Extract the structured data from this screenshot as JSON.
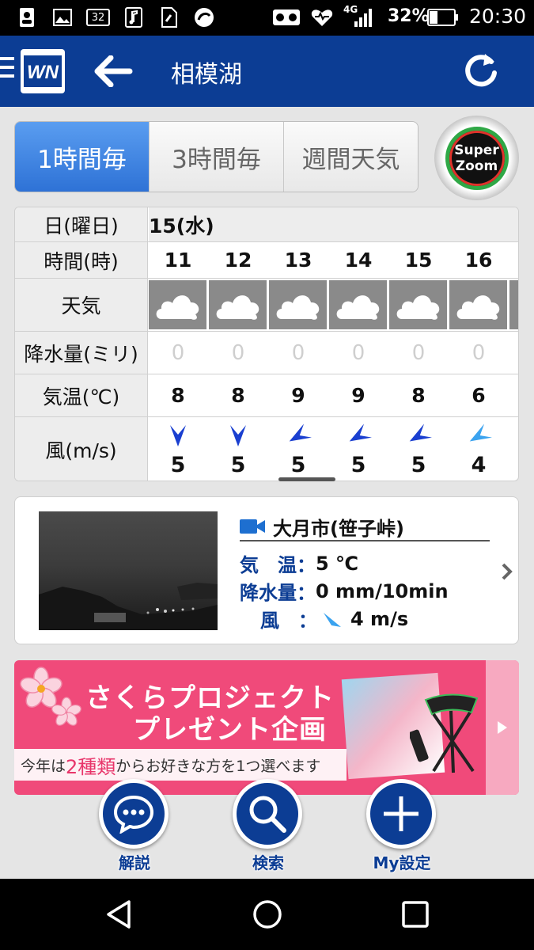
{
  "status_bar": {
    "notif_badge": "32",
    "network": "4G",
    "battery": "32%",
    "time": "20:30"
  },
  "app_bar": {
    "logo_text": "WN",
    "title": "相模湖"
  },
  "tabs": [
    {
      "label": "1時間毎",
      "active": true
    },
    {
      "label": "3時間毎",
      "active": false
    },
    {
      "label": "週間天気",
      "active": false
    }
  ],
  "super_zoom": {
    "line1": "Super",
    "line2": "Zoom"
  },
  "forecast": {
    "labels": {
      "date": "日(曜日)",
      "hour": "時間(時)",
      "weather": "天気",
      "precip": "降水量(ミリ)",
      "temp": "気温(℃)",
      "wind": "風(m/s)"
    },
    "date": "15(水)",
    "hours": [
      {
        "hour": "11",
        "weather": "cloudy",
        "precip": "0",
        "temp": "8",
        "wind_speed": "5",
        "wind_dir_deg": 180
      },
      {
        "hour": "12",
        "weather": "cloudy",
        "precip": "0",
        "temp": "8",
        "wind_speed": "5",
        "wind_dir_deg": 180
      },
      {
        "hour": "13",
        "weather": "cloudy",
        "precip": "0",
        "temp": "9",
        "wind_speed": "5",
        "wind_dir_deg": 240
      },
      {
        "hour": "14",
        "weather": "cloudy",
        "precip": "0",
        "temp": "9",
        "wind_speed": "5",
        "wind_dir_deg": 240
      },
      {
        "hour": "15",
        "weather": "cloudy",
        "precip": "0",
        "temp": "8",
        "wind_speed": "5",
        "wind_dir_deg": 240
      },
      {
        "hour": "16",
        "weather": "cloudy",
        "precip": "0",
        "temp": "6",
        "wind_speed": "4",
        "wind_dir_deg": 240
      }
    ]
  },
  "live_camera": {
    "station": "大月市(笹子峠)",
    "temp_label": "気　温：",
    "temp_value": "5 ℃",
    "precip_label": "降水量：",
    "precip_value": "0 mm/10min",
    "wind_label": "風　：",
    "wind_value": "4 m/s"
  },
  "banner": {
    "headline1": "さくらプロジェクト",
    "headline2": "プレゼント企画",
    "sub_prefix": "今年は",
    "sub_highlight": "2種類",
    "sub_suffix": "からお好きな方を1つ選べます"
  },
  "bottom_buttons": [
    {
      "label": "解説",
      "icon": "chat-icon"
    },
    {
      "label": "検索",
      "icon": "search-icon"
    },
    {
      "label": "My設定",
      "icon": "plus-icon"
    }
  ],
  "colors": {
    "brand": "#0c3d94",
    "tab_active": "#3a80e0",
    "wind_strong": "#1a3fd0",
    "wind_light": "#3ba3ef",
    "banner": "#f04a7a"
  }
}
